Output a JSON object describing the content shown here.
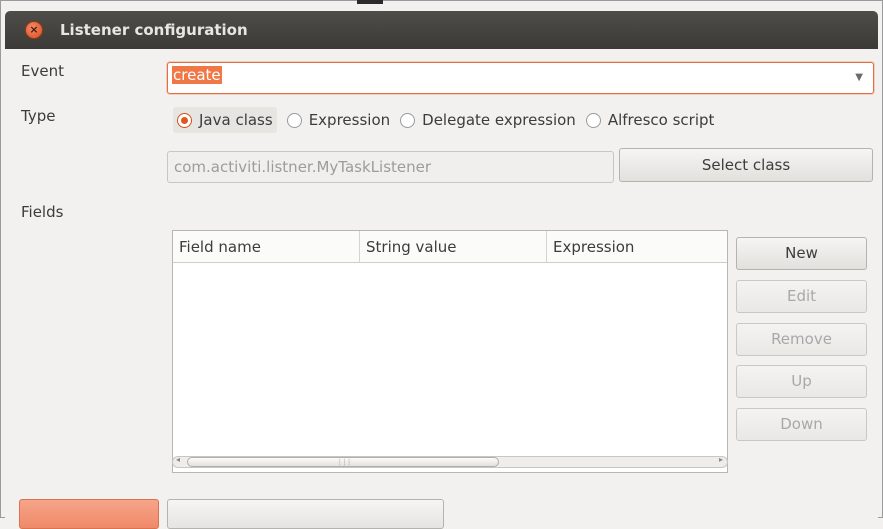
{
  "window": {
    "title": "Listener configuration",
    "close_icon": "close-icon"
  },
  "form": {
    "event_label": "Event",
    "event_value": "create",
    "type_label": "Type",
    "type_options": [
      {
        "label": "Java class",
        "selected": true
      },
      {
        "label": "Expression",
        "selected": false
      },
      {
        "label": "Delegate expression",
        "selected": false
      },
      {
        "label": "Alfresco script",
        "selected": false
      }
    ],
    "class_placeholder": "com.activiti.listner.MyTaskListener",
    "select_class_label": "Select class",
    "fields_label": "Fields"
  },
  "table": {
    "columns": [
      "Field name",
      "String value",
      "Expression"
    ],
    "rows": []
  },
  "side_buttons": {
    "new": "New",
    "edit": "Edit",
    "remove": "Remove",
    "up": "Up",
    "down": "Down"
  },
  "colors": {
    "accent": "#e2571d",
    "titlebar": "#3e3d39",
    "ok_button": "#f0906f"
  }
}
